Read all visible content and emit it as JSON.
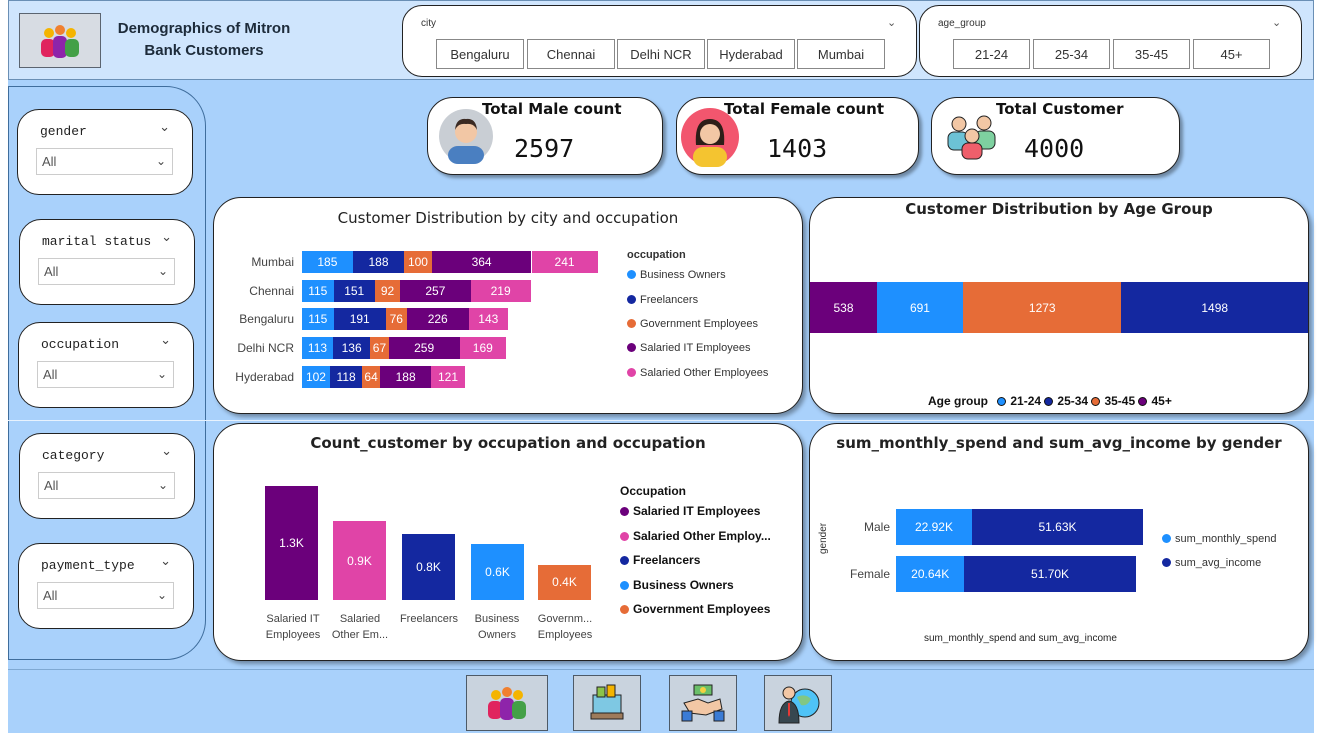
{
  "header": {
    "title_line1": "Demographics of Mitron",
    "title_line2": "Bank Customers"
  },
  "city_slicer": {
    "label": "city",
    "options": [
      "Bengaluru",
      "Chennai",
      "Delhi NCR",
      "Hyderabad",
      "Mumbai"
    ]
  },
  "age_slicer": {
    "label": "age_group",
    "options": [
      "21-24",
      "25-34",
      "35-45",
      "45+"
    ]
  },
  "left_slicers": [
    {
      "label": "gender",
      "value": "All"
    },
    {
      "label": "marital status",
      "value": "All"
    },
    {
      "label": "occupation",
      "value": "All"
    },
    {
      "label": "category",
      "value": "All"
    },
    {
      "label": "payment_type",
      "value": "All"
    }
  ],
  "kpis": [
    {
      "title": "Total Male count",
      "value": "2597",
      "icon": "male-avatar-icon"
    },
    {
      "title": "Total Female count",
      "value": "1403",
      "icon": "female-avatar-icon"
    },
    {
      "title": "Total Customer",
      "value": "4000",
      "icon": "group-icon"
    }
  ],
  "colors": {
    "business": "#1e90ff",
    "freelancers": "#1428a0",
    "government": "#e66c37",
    "salaried_it": "#6b007b",
    "salaried_other": "#e044a7"
  },
  "city_chart": {
    "title": "Customer Distribution by city and occupation",
    "legend_title": "occupation",
    "legend": [
      "Business Owners",
      "Freelancers",
      "Government Employees",
      "Salaried IT Employees",
      "Salaried Other Employees"
    ]
  },
  "age_chart": {
    "title": "Customer Distribution by Age Group",
    "legend_title": "Age group",
    "legend": [
      "21-24",
      "25-34",
      "35-45",
      "45+"
    ]
  },
  "occ_chart": {
    "title": "Count_customer by occupation and occupation",
    "legend_title": "Occupation",
    "legend": [
      "Salaried IT Employees",
      "Salaried Other Employ...",
      "Freelancers",
      "Business Owners",
      "Government Employees"
    ],
    "xlabels": [
      [
        "Salaried IT",
        "Employees"
      ],
      [
        "Salaried",
        "Other Em..."
      ],
      [
        "Freelancers",
        ""
      ],
      [
        "Business",
        "Owners"
      ],
      [
        "Governm...",
        "Employees"
      ]
    ]
  },
  "gender_chart": {
    "title": "sum_monthly_spend and sum_avg_income by gender",
    "ylabel": "gender",
    "xlabel": "sum_monthly_spend and sum_avg_income",
    "legend": [
      "sum_monthly_spend",
      "sum_avg_income"
    ]
  },
  "chart_data": [
    {
      "type": "bar",
      "orientation": "horizontal-stacked",
      "title": "Customer Distribution by city and occupation",
      "categories": [
        "Mumbai",
        "Chennai",
        "Bengaluru",
        "Delhi NCR",
        "Hyderabad"
      ],
      "series": [
        {
          "name": "Business Owners",
          "values": [
            185,
            115,
            115,
            113,
            102
          ],
          "labels": [
            "185",
            "115",
            "115",
            "113",
            "102"
          ]
        },
        {
          "name": "Freelancers",
          "values": [
            188,
            151,
            191,
            136,
            118
          ],
          "labels": [
            "188",
            "151",
            "191",
            "136",
            "118"
          ]
        },
        {
          "name": "Government Employees",
          "values": [
            100,
            92,
            76,
            67,
            64
          ],
          "labels": [
            "100",
            "92",
            "76",
            "67",
            "64"
          ]
        },
        {
          "name": "Salaried IT Employees",
          "values": [
            364,
            257,
            226,
            259,
            188
          ],
          "labels": [
            "364",
            "257",
            "226",
            "259",
            "188"
          ]
        },
        {
          "name": "Salaried Other Employees",
          "values": [
            241,
            219,
            143,
            169,
            121
          ],
          "labels": [
            "241",
            "219",
            "143",
            "169",
            "121"
          ]
        }
      ]
    },
    {
      "type": "bar",
      "orientation": "horizontal-stacked-100",
      "title": "Customer Distribution by Age Group",
      "series": [
        {
          "name": "45+",
          "value": 538,
          "label": "538"
        },
        {
          "name": "21-24",
          "value": 691,
          "label": "691"
        },
        {
          "name": "35-45",
          "value": 1273,
          "label": "1273"
        },
        {
          "name": "25-34",
          "value": 1498,
          "label": "1498"
        }
      ]
    },
    {
      "type": "bar",
      "title": "Count_customer by occupation and occupation",
      "categories": [
        "Salaried IT Employees",
        "Salaried Other Employees",
        "Freelancers",
        "Business Owners",
        "Government Employees"
      ],
      "values": [
        1294,
        893,
        749,
        630,
        399
      ],
      "labels": [
        "1.3K",
        "0.9K",
        "0.8K",
        "0.6K",
        "0.4K"
      ]
    },
    {
      "type": "bar",
      "orientation": "horizontal-stacked",
      "title": "sum_monthly_spend and sum_avg_income by gender",
      "categories": [
        "Male",
        "Female"
      ],
      "series": [
        {
          "name": "sum_monthly_spend",
          "values": [
            22920,
            20640
          ],
          "labels": [
            "22.92K",
            "20.64K"
          ]
        },
        {
          "name": "sum_avg_income",
          "values": [
            51630,
            51700
          ],
          "labels": [
            "51.63K",
            "51.70K"
          ]
        }
      ]
    }
  ],
  "nav": [
    "demographics-icon",
    "spending-icon",
    "handshake-icon",
    "business-globe-icon"
  ]
}
